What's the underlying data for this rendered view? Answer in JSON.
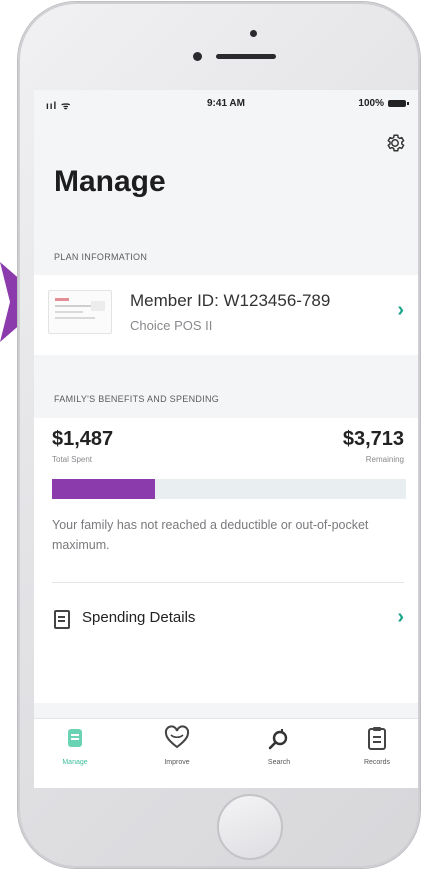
{
  "status_bar": {
    "signal": "ııl ᯤ",
    "time": "9:41 AM",
    "battery": "100%"
  },
  "page": {
    "title": "Manage",
    "settings_icon": "gear-icon"
  },
  "plan_information": {
    "header": "PLAN INFORMATION",
    "member_id": "Member ID: W123456-789",
    "plan_name": "Choice POS II",
    "chevron": "›"
  },
  "benefits": {
    "header": "FAMILY'S BENEFITS AND SPENDING",
    "total_spent_amount": "$1,487",
    "total_spent_label": "Total Spent",
    "remaining_amount": "$3,713",
    "remaining_label": "Remaining",
    "progress_fraction": 0.29,
    "progress_color": "#8b3bab",
    "note": "Your family has not reached a deductible or out-of-pocket maximum.",
    "spending_details_label": "Spending Details",
    "chevron": "›"
  },
  "tabbar": {
    "tabs": [
      {
        "label": "Manage",
        "icon": "manage-icon",
        "active": true
      },
      {
        "label": "Improve",
        "icon": "heart-icon",
        "active": false
      },
      {
        "label": "Search",
        "icon": "search-icon",
        "active": false
      },
      {
        "label": "Records",
        "icon": "clipboard-icon",
        "active": false
      }
    ]
  },
  "colors": {
    "accent": "#1aa58a",
    "purple": "#8b3bab",
    "active_tab": "#3fbf9a"
  }
}
